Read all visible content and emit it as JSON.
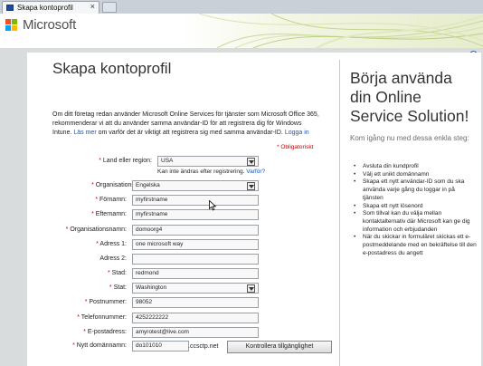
{
  "browser": {
    "tab_title": "Skapa kontoprofil",
    "tab_close": "×"
  },
  "header": {
    "brand": "Microsoft",
    "logo_colors": [
      "#f25022",
      "#7fba00",
      "#00a4ef",
      "#ffb900"
    ]
  },
  "help_icon": "?",
  "form": {
    "title": "Skapa kontoprofil",
    "intro_text": "Om ditt företag redan använder Microsoft Online Services för tjänster som Microsoft Office 365, rekommenderar vi att du använder samma användar-ID för att registrera dig för Windows Intune.",
    "learn_more_link": "Läs mer",
    "intro_text2": "om varför det är viktigt att registrera sig med samma användar-ID.",
    "login_link": "Logga in",
    "required_note": "* Obligatoriskt",
    "country_hint": "Kan inte ändras efter registrering.",
    "country_hint_link": "Varför?",
    "fields": {
      "country": {
        "label": "Land eller region:",
        "value": "USA"
      },
      "org_language": {
        "label": "Organisationsspråk:",
        "value": "Engelska"
      },
      "first_name": {
        "label": "Förnamn:",
        "value": "myfirstname"
      },
      "last_name": {
        "label": "Efternamn:",
        "value": "myfirstname"
      },
      "org_name": {
        "label": "Organisationsnamn:",
        "value": "domoorg4"
      },
      "address1": {
        "label": "Adress 1:",
        "value": "one microsoft way"
      },
      "address2": {
        "label": "Adress 2:",
        "value": ""
      },
      "city": {
        "label": "Stad:",
        "value": "redmond"
      },
      "state": {
        "label": "Stat:",
        "value": "Washington"
      },
      "postal_code": {
        "label": "Postnummer:",
        "value": "98052"
      },
      "phone": {
        "label": "Telefonnummer:",
        "value": "4252222222"
      },
      "email": {
        "label": "E-postadress:",
        "value": "amyrotest@live.com"
      },
      "domain": {
        "label": "Nytt domännamn:",
        "value": "do101010"
      }
    },
    "domain_suffix": ".ccsctp.net",
    "check_button": "Kontrollera tillgänglighet"
  },
  "side_panel": {
    "title": "Börja använda din Online Service Solution!",
    "subtitle": "Kom igång nu med dessa enkla steg:",
    "steps": [
      "Avsluta din kundprofil",
      "Välj ett unikt domännamn",
      "Skapa ett nytt användar-ID som du ska använda varje gång du loggar in på tjänsten",
      "Skapa ett nytt lösenord",
      "Som tillval kan du välja mellan kontaktalternativ där Microsoft kan ge dig information och erbjudanden",
      "När du skickar in formuläret skickas ett e-postmeddelande med en bekräftelse till den e-postadress du angett"
    ]
  }
}
